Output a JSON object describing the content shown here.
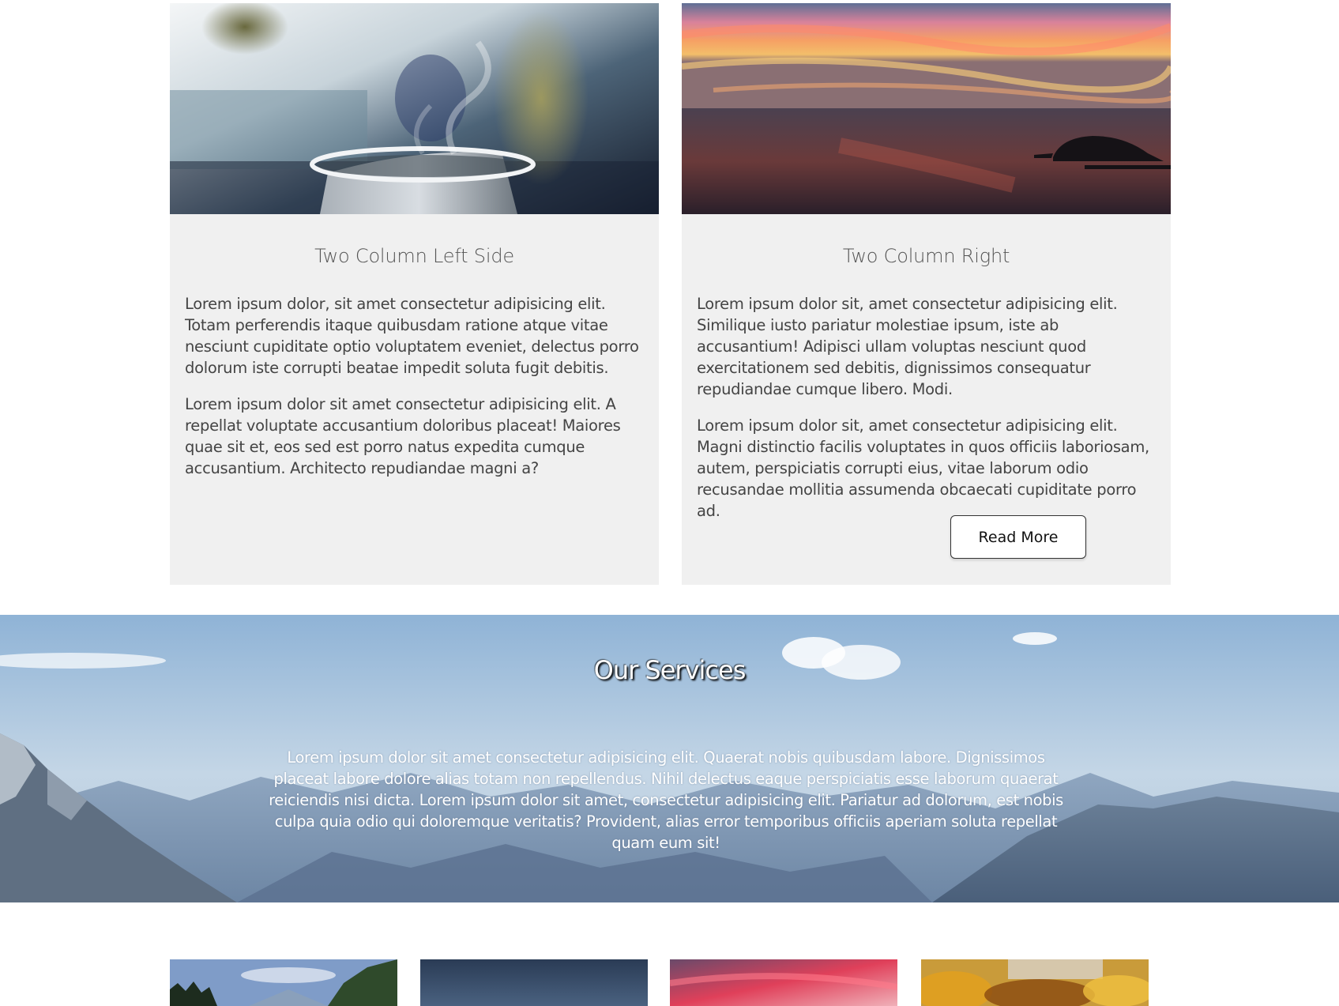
{
  "two_column": {
    "left": {
      "image": "steaming-cup-image",
      "title": "Two Column Left Side",
      "paragraphs": [
        "Lorem ipsum dolor, sit amet consectetur adipisicing elit. Totam perferendis itaque quibusdam ratione atque vitae nesciunt cupiditate optio voluptatem eveniet, delectus porro dolorum iste corrupti beatae impedit soluta fugit debitis.",
        "Lorem ipsum dolor sit amet consectetur adipisicing elit. A repellat voluptate accusantium doloribus placeat! Maiores quae sit et, eos sed est porro natus expedita cumque accusantium. Architecto repudiandae magni a?"
      ]
    },
    "right": {
      "image": "sunset-sea-image",
      "title": "Two Column Right",
      "paragraphs": [
        "Lorem ipsum dolor sit, amet consectetur adipisicing elit. Similique iusto pariatur molestiae ipsum, iste ab accusantium! Adipisci ullam voluptas nesciunt quod exercitationem sed debitis, dignissimos consequatur repudiandae cumque libero. Modi.",
        "Lorem ipsum dolor sit, amet consectetur adipisicing elit. Magni distinctio facilis voluptates in quos officiis laboriosam, autem, perspiciatis corrupti eius, vitae laborum odio recusandae mollitia assumenda obcaecati cupiditate porro ad."
      ],
      "button_label": "Read More"
    }
  },
  "services": {
    "background": "mountain-range-image",
    "title": "Our Services",
    "text": "Lorem ipsum dolor sit amet consectetur adipisicing elit. Quaerat nobis quibusdam labore. Dignissimos placeat labore dolore alias totam non repellendus. Nihil delectus eaque perspiciatis esse laborum quaerat reiciendis nisi dicta. Lorem ipsum dolor sit amet, consectetur adipisicing elit. Pariatur ad dolorum, est nobis culpa quia odio qui doloremque veritatis? Provident, alias error temporibus officiis aperiam soluta repellat quam eum sit!"
  },
  "gallery": [
    "forest-mountain-image",
    "dark-sky-image",
    "pink-clouds-image",
    "autumn-leaves-image"
  ],
  "colors": {
    "card_bg": "#f0f0f0",
    "page_bg": "#ffffff",
    "button_border": "#333333",
    "text": "#444444"
  }
}
